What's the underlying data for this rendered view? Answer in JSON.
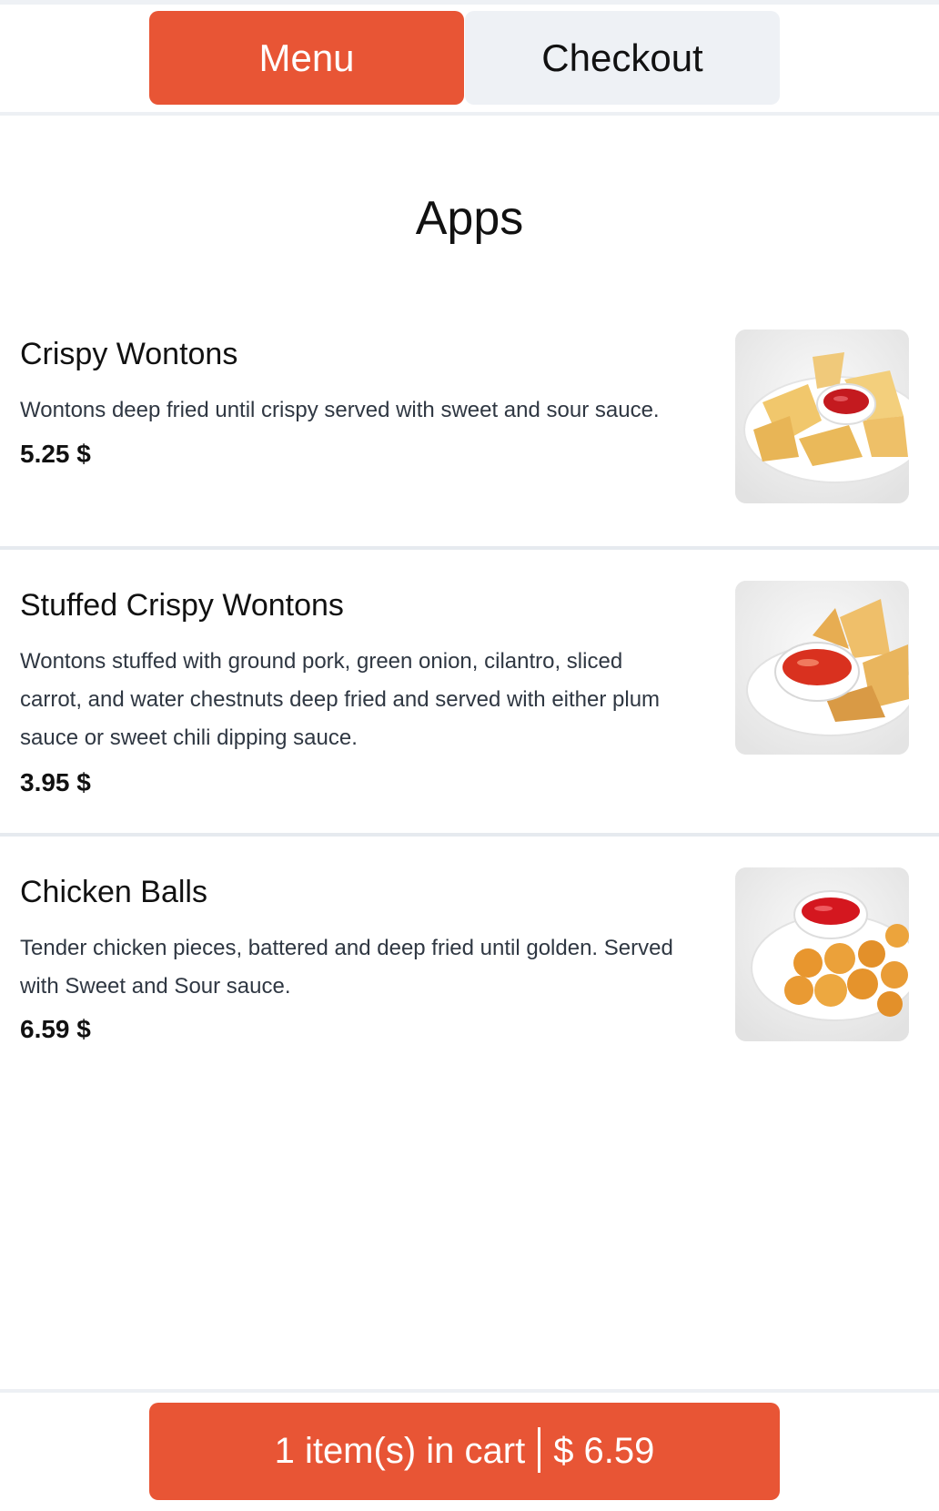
{
  "nav": {
    "tabs": [
      {
        "label": "Menu",
        "active": true
      },
      {
        "label": "Checkout",
        "active": false
      }
    ]
  },
  "section": {
    "title": "Apps"
  },
  "items": [
    {
      "name": "Crispy Wontons",
      "description": "Wontons deep fried until crispy served with sweet and sour sauce.",
      "price": "5.25 $",
      "image": "crispy-wontons-photo"
    },
    {
      "name": "Stuffed Crispy Wontons",
      "description": "Wontons stuffed with ground pork, green onion, cilantro, sliced carrot, and water chestnuts deep fried and served with either plum sauce or sweet chili dipping sauce.",
      "price": "3.95 $",
      "image": "stuffed-wontons-photo"
    },
    {
      "name": "Chicken Balls",
      "description": "Tender chicken pieces, battered and deep fried until golden. Served with Sweet and Sour sauce.",
      "price": "6.59 $",
      "image": "chicken-balls-photo"
    }
  ],
  "cart": {
    "count_text": "1 item(s) in cart",
    "total_text": "$ 6.59"
  },
  "colors": {
    "accent": "#e85535",
    "inactive_tab": "#eef1f5",
    "divider": "#e6eaef"
  }
}
